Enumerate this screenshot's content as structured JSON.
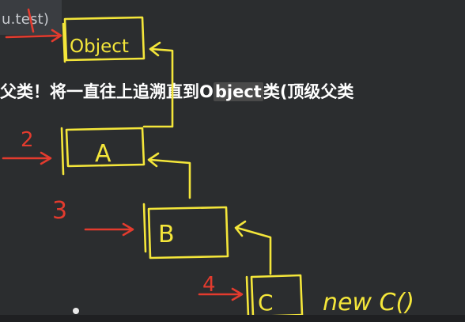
{
  "topbar": {
    "text": "u.test)"
  },
  "caption": {
    "pre": "父类！将一直往上追溯直到O",
    "highlight": "bject",
    "post": "类(顶级父类"
  },
  "diagram": {
    "nodes": [
      {
        "id": "object",
        "label": "Object",
        "number": ""
      },
      {
        "id": "a",
        "label": "A",
        "number": "2"
      },
      {
        "id": "b",
        "label": "B",
        "number": "3"
      },
      {
        "id": "c",
        "label": "C",
        "number": "4"
      }
    ],
    "annotation": "new C()"
  },
  "colors": {
    "ink_yellow": "#f4e63a",
    "ink_red": "#e33b2e",
    "background": "#2b2d2f"
  }
}
